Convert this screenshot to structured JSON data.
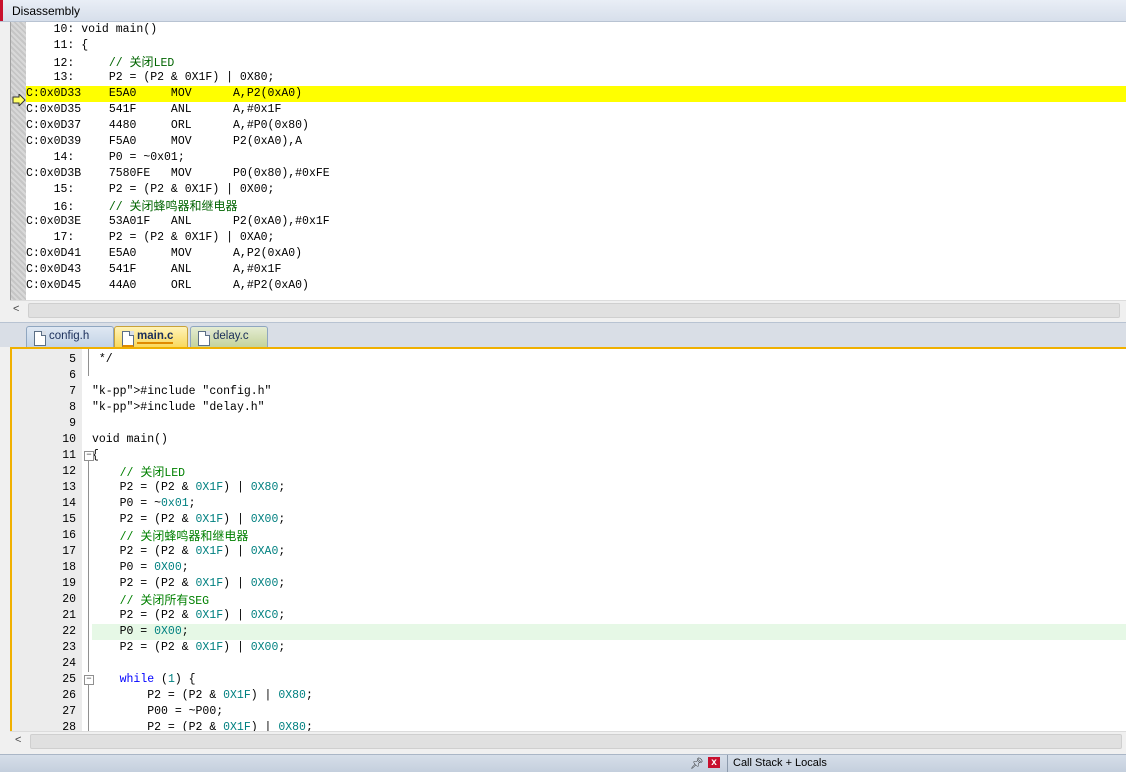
{
  "disassembly": {
    "title": "Disassembly",
    "lines": [
      {
        "kind": "src",
        "text": "    10: void main()"
      },
      {
        "kind": "src",
        "text": "    11: {"
      },
      {
        "kind": "src",
        "text": "    12:     // 关闭LED"
      },
      {
        "kind": "src",
        "text": "    13:     P2 = (P2 & 0X1F) | 0X80;"
      },
      {
        "kind": "asm",
        "current": true,
        "text": "C:0x0D33    E5A0     MOV      A,P2(0xA0)"
      },
      {
        "kind": "asm",
        "text": "C:0x0D35    541F     ANL      A,#0x1F"
      },
      {
        "kind": "asm",
        "text": "C:0x0D37    4480     ORL      A,#P0(0x80)"
      },
      {
        "kind": "asm",
        "text": "C:0x0D39    F5A0     MOV      P2(0xA0),A"
      },
      {
        "kind": "src",
        "text": "    14:     P0 = ~0x01;"
      },
      {
        "kind": "asm",
        "text": "C:0x0D3B    7580FE   MOV      P0(0x80),#0xFE"
      },
      {
        "kind": "src",
        "text": "    15:     P2 = (P2 & 0X1F) | 0X00;"
      },
      {
        "kind": "src",
        "text": "    16:     // 关闭蜂鸣器和继电器"
      },
      {
        "kind": "asm",
        "text": "C:0x0D3E    53A01F   ANL      P2(0xA0),#0x1F"
      },
      {
        "kind": "src",
        "text": "    17:     P2 = (P2 & 0X1F) | 0XA0;"
      },
      {
        "kind": "asm",
        "text": "C:0x0D41    E5A0     MOV      A,P2(0xA0)"
      },
      {
        "kind": "asm",
        "text": "C:0x0D43    541F     ANL      A,#0x1F"
      },
      {
        "kind": "asm",
        "text": "C:0x0D45    44A0     ORL      A,#P2(0xA0)"
      }
    ]
  },
  "tabs": [
    {
      "label": "config.h",
      "active": false
    },
    {
      "label": "main.c",
      "active": true
    },
    {
      "label": "delay.c",
      "active": false
    }
  ],
  "editor": {
    "lines": [
      {
        "n": "5",
        "code": " */"
      },
      {
        "n": "6",
        "code": ""
      },
      {
        "n": "7",
        "code": "#include \"config.h\""
      },
      {
        "n": "8",
        "code": "#include \"delay.h\""
      },
      {
        "n": "9",
        "code": ""
      },
      {
        "n": "10",
        "code": "void main()"
      },
      {
        "n": "11",
        "code": "{"
      },
      {
        "n": "12",
        "code": "    // 关闭LED"
      },
      {
        "n": "13",
        "code": "    P2 = (P2 & 0X1F) | 0X80;"
      },
      {
        "n": "14",
        "code": "    P0 = ~0x01;"
      },
      {
        "n": "15",
        "code": "    P2 = (P2 & 0X1F) | 0X00;"
      },
      {
        "n": "16",
        "code": "    // 关闭蜂鸣器和继电器"
      },
      {
        "n": "17",
        "code": "    P2 = (P2 & 0X1F) | 0XA0;"
      },
      {
        "n": "18",
        "code": "    P0 = 0X00;"
      },
      {
        "n": "19",
        "code": "    P2 = (P2 & 0X1F) | 0X00;"
      },
      {
        "n": "20",
        "code": "    // 关闭所有SEG"
      },
      {
        "n": "21",
        "code": "    P2 = (P2 & 0X1F) | 0XC0;"
      },
      {
        "n": "22",
        "code": "    P0 = 0X00;"
      },
      {
        "n": "23",
        "code": "    P2 = (P2 & 0X1F) | 0X00;"
      },
      {
        "n": "24",
        "code": ""
      },
      {
        "n": "25",
        "code": "    while (1) {"
      },
      {
        "n": "26",
        "code": "        P2 = (P2 & 0X1F) | 0X80;"
      },
      {
        "n": "27",
        "code": "        P00 = ~P00;"
      },
      {
        "n": "28",
        "code": "        P2 = (P2 & 0X1F) | 0X80;"
      }
    ],
    "highlighted_line": "22"
  },
  "bottom_panel": {
    "title": "Call Stack + Locals",
    "pin_icon": "pin-icon",
    "close_icon": "close-icon"
  },
  "colors": {
    "current_line": "#ffff00",
    "preprocessor": "#808000",
    "string": "#800000",
    "keyword": "#0000ff",
    "number": "#008080",
    "comment": "#008000",
    "highlight_line": "#e6f8e6"
  }
}
